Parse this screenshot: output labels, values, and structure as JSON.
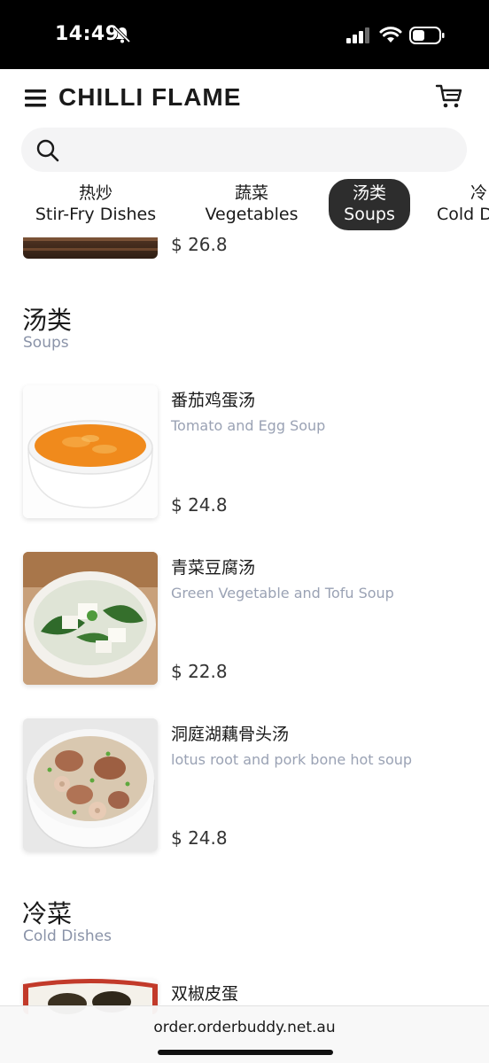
{
  "status_bar": {
    "time": "14:49"
  },
  "header": {
    "brand": "CHILLI FLAME"
  },
  "search": {
    "placeholder": ""
  },
  "tabs": [
    {
      "zh": "热炒",
      "en": "Stir-Fry Dishes",
      "active": false
    },
    {
      "zh": "蔬菜",
      "en": "Vegetables",
      "active": false
    },
    {
      "zh": "汤类",
      "en": "Soups",
      "active": true
    },
    {
      "zh": "冷",
      "en": "Cold D",
      "active": false
    }
  ],
  "partial_item": {
    "price": "$ 26.8"
  },
  "sections": [
    {
      "title_zh": "汤类",
      "title_en": "Soups",
      "items": [
        {
          "name_zh": "番茄鸡蛋汤",
          "name_en": "Tomato and Egg Soup",
          "price": "$ 24.8"
        },
        {
          "name_zh": "青菜豆腐汤",
          "name_en": "Green Vegetable and Tofu Soup",
          "price": "$ 22.8"
        },
        {
          "name_zh": "洞庭湖藕骨头汤",
          "name_en": "lotus root and pork bone hot soup",
          "price": "$ 24.8"
        }
      ]
    },
    {
      "title_zh": "冷菜",
      "title_en": "Cold Dishes",
      "items": [
        {
          "name_zh": "双椒皮蛋"
        }
      ]
    }
  ],
  "browser": {
    "url": "order.orderbuddy.net.au"
  },
  "colors": {
    "accent_tab": "#2d2d2d",
    "muted_text": "#9aa2b4",
    "search_bg": "#f4f4f5"
  },
  "icons": [
    "bell-slash-icon",
    "signal-icon",
    "wifi-icon",
    "battery-icon",
    "menu-icon",
    "cart-icon",
    "search-icon"
  ]
}
